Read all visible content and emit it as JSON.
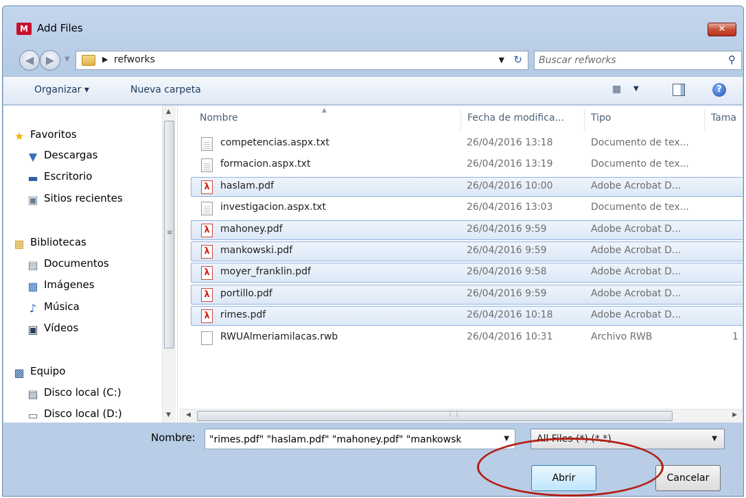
{
  "window": {
    "title": "Add Files",
    "app_logo": "M",
    "close_label": "✕"
  },
  "nav": {
    "path": "refworks",
    "search_placeholder": "Buscar refworks"
  },
  "toolbar": {
    "organize": "Organizar ▾",
    "new_folder": "Nueva carpeta"
  },
  "sidebar": {
    "favorites": "Favoritos",
    "downloads": "Descargas",
    "desktop": "Escritorio",
    "recent": "Sitios recientes",
    "libraries": "Bibliotecas",
    "documents": "Documentos",
    "images": "Imágenes",
    "music": "Música",
    "videos": "Vídeos",
    "computer": "Equipo",
    "disk_c": "Disco local (C:)",
    "disk_d": "Disco local (D:)"
  },
  "columns": {
    "name": "Nombre",
    "date": "Fecha de modifica...",
    "type": "Tipo",
    "size": "Tama"
  },
  "files": [
    {
      "name": "competencias.aspx.txt",
      "date": "26/04/2016 13:18",
      "type": "Documento de tex...",
      "size": "",
      "icon": "txt",
      "selected": false
    },
    {
      "name": "formacion.aspx.txt",
      "date": "26/04/2016 13:19",
      "type": "Documento de tex...",
      "size": "",
      "icon": "txt",
      "selected": false
    },
    {
      "name": "haslam.pdf",
      "date": "26/04/2016 10:00",
      "type": "Adobe Acrobat D...",
      "size": "",
      "icon": "pdf",
      "selected": true
    },
    {
      "name": "investigacion.aspx.txt",
      "date": "26/04/2016 13:03",
      "type": "Documento de tex...",
      "size": "",
      "icon": "txt",
      "selected": false
    },
    {
      "name": "mahoney.pdf",
      "date": "26/04/2016 9:59",
      "type": "Adobe Acrobat D...",
      "size": "",
      "icon": "pdf",
      "selected": true
    },
    {
      "name": "mankowski.pdf",
      "date": "26/04/2016 9:59",
      "type": "Adobe Acrobat D...",
      "size": "",
      "icon": "pdf",
      "selected": true
    },
    {
      "name": "moyer_franklin.pdf",
      "date": "26/04/2016 9:58",
      "type": "Adobe Acrobat D...",
      "size": "",
      "icon": "pdf",
      "selected": true
    },
    {
      "name": "portillo.pdf",
      "date": "26/04/2016 9:59",
      "type": "Adobe Acrobat D...",
      "size": "",
      "icon": "pdf",
      "selected": true
    },
    {
      "name": "rimes.pdf",
      "date": "26/04/2016 10:18",
      "type": "Adobe Acrobat D...",
      "size": "",
      "icon": "pdf",
      "selected": true
    },
    {
      "name": "RWUAlmeriamilacas.rwb",
      "date": "26/04/2016 10:31",
      "type": "Archivo RWB",
      "size": "1",
      "icon": "rwb",
      "selected": false
    }
  ],
  "footer": {
    "filename_label": "Nombre:",
    "filename_value": "\"rimes.pdf\" \"haslam.pdf\" \"mahoney.pdf\" \"mankowsk",
    "filter": "All Files (*) (*.*)",
    "open": "Abrir",
    "cancel": "Cancelar"
  },
  "colors": {
    "selection": "#dce8f7",
    "highlight_ellipse": "#b21f16"
  }
}
